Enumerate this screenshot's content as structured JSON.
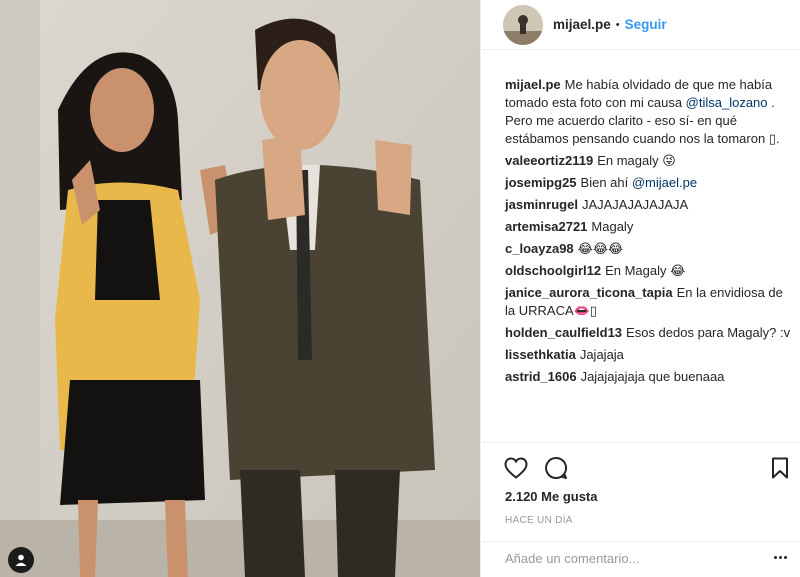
{
  "post": {
    "photo_alt": "",
    "badge_icon": "user-tag-icon"
  },
  "header": {
    "username": "mijael.pe",
    "separator": "•",
    "follow_label": "Seguir"
  },
  "caption": {
    "user": "mijael.pe",
    "text_before": "Me había olvidado de que me había tomado esta foto con mi causa ",
    "mention": "@tilsa_lozano",
    "text_after": " . Pero me acuerdo clarito - eso sí- en qué estábamos pensando cuando nos la tomaron ▯."
  },
  "comments": [
    {
      "user": "valeeortiz2119",
      "text": "En magaly 😜"
    },
    {
      "user": "josemipg25",
      "text": "Bien ahí ",
      "mention": "@mijael.pe"
    },
    {
      "user": "jasminrugel",
      "text": "JAJAJAJAJAJAJA"
    },
    {
      "user": "artemisa2721",
      "text": "Magaly"
    },
    {
      "user": "c_loayza98",
      "text": "😂😂😂"
    },
    {
      "user": "oldschoolgirl12",
      "text": "En Magaly 😂"
    },
    {
      "user": "janice_aurora_ticona_tapia",
      "text": "En la envidiosa de la URRACA👄▯"
    },
    {
      "user": "holden_caulfield13",
      "text": "Esos dedos para Magaly? :v"
    },
    {
      "user": "lissethkatia",
      "text": "Jajajaja"
    },
    {
      "user": "astrid_1606",
      "text": "Jajajajajaja que buenaaa"
    }
  ],
  "actions": {
    "likes": "2.120 Me gusta",
    "time": "HACE UN DÍA",
    "comment_placeholder": "Añade un comentario..."
  },
  "colors": {
    "link": "#3897f0",
    "mention": "#003569",
    "muted": "#999999"
  }
}
